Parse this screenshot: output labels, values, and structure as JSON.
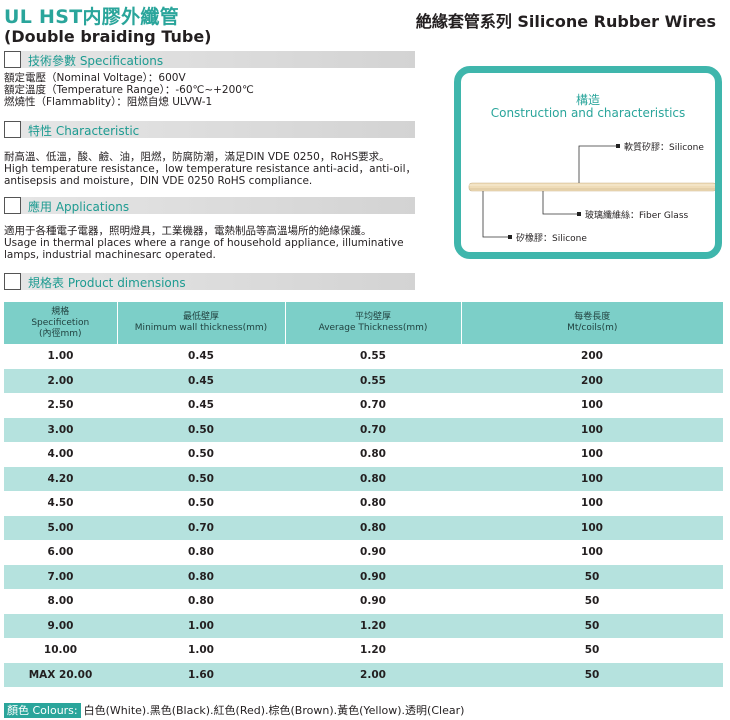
{
  "header": {
    "title": "UL HST内膠外纖管",
    "subtitle": "(Double braiding Tube)",
    "series": "絶緣套管系列 Silicone Rubber Wires"
  },
  "sections": {
    "specs": {
      "label": "技術參數 Specifications",
      "lines": [
        "額定電壓（Nominal Voltage）：600V",
        "額定溫度（Temperature Range）：-60℃~+200℃",
        "燃燒性（Flammablity）：阻燃自熄 ULVW-1"
      ]
    },
    "characteristic": {
      "label": "特性 Characteristic",
      "lines": [
        "耐高溫、低溫，酸、鹼、油，阻燃，防腐防潮，滿足DIN VDE 0250，RoHS要求。",
        "High temperature resistance，low temperature resistance anti-acid，anti-oil，",
        "antisepsis and moisture，DIN VDE 0250 RoHS compliance."
      ]
    },
    "applications": {
      "label": "應用 Applications",
      "lines": [
        "適用于各種電子電器，照明燈具，工業機器，電熱制品等高溫場所的絶緣保護。",
        "Usage in thermal places where a range of household appliance, illuminative",
        "lamps, industrial machinesarc operated."
      ]
    },
    "dimensions": {
      "label": "規格表 Product dimensions"
    }
  },
  "construction": {
    "title_cn": "構造",
    "title_en": "Construction and characteristics",
    "labels": {
      "outer": "軟質矽膠：Silicone",
      "braid": "玻璃纖維絲：Fiber Glass",
      "inner": "矽橡膠：Silicone"
    },
    "colors": {
      "frame": "#3fb6ac",
      "tube": "#efdcb8"
    }
  },
  "table": {
    "headers": [
      {
        "cn": "規格",
        "en": "Specificetion",
        "unit": "(內徑mm)"
      },
      {
        "cn": "最低壁厚",
        "en": "Minimum wall thickness(mm)",
        "unit": ""
      },
      {
        "cn": "平均壁厚",
        "en": "Average Thickness(mm)",
        "unit": ""
      },
      {
        "cn": "每卷長度",
        "en": "Mt/coils(m)",
        "unit": ""
      }
    ],
    "rows": [
      [
        "1.00",
        "0.45",
        "0.55",
        "200"
      ],
      [
        "2.00",
        "0.45",
        "0.55",
        "200"
      ],
      [
        "2.50",
        "0.45",
        "0.70",
        "100"
      ],
      [
        "3.00",
        "0.50",
        "0.70",
        "100"
      ],
      [
        "4.00",
        "0.50",
        "0.80",
        "100"
      ],
      [
        "4.20",
        "0.50",
        "0.80",
        "100"
      ],
      [
        "4.50",
        "0.50",
        "0.80",
        "100"
      ],
      [
        "5.00",
        "0.70",
        "0.80",
        "100"
      ],
      [
        "6.00",
        "0.80",
        "0.90",
        "100"
      ],
      [
        "7.00",
        "0.80",
        "0.90",
        "50"
      ],
      [
        "8.00",
        "0.80",
        "0.90",
        "50"
      ],
      [
        "9.00",
        "1.00",
        "1.20",
        "50"
      ],
      [
        "10.00",
        "1.00",
        "1.20",
        "50"
      ],
      [
        "MAX 20.00",
        "1.60",
        "2.00",
        "50"
      ]
    ],
    "colors": {
      "header": "#7ccfc8",
      "stripe": "#b5e2de"
    }
  },
  "colours": {
    "label": "顏色 Colours:",
    "value": "白色(White).黑色(Black).紅色(Red).棕色(Brown).黃色(Yellow).透明(Clear)"
  },
  "accent": "#2aa59b"
}
